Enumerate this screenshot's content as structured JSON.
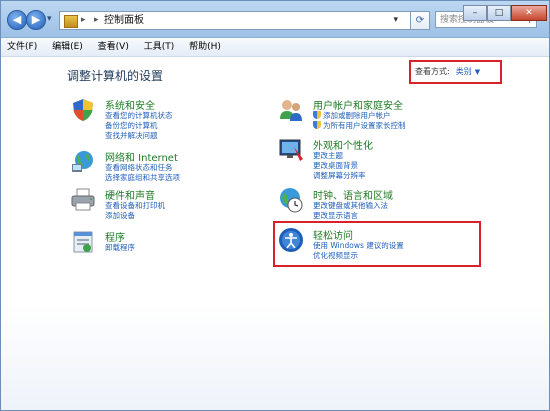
{
  "window": {
    "address_path": "控制面板",
    "search_placeholder": "搜索控制面板"
  },
  "menu": [
    "文件(F)",
    "编辑(E)",
    "查看(V)",
    "工具(T)",
    "帮助(H)"
  ],
  "main": {
    "heading": "调整计算机的设置",
    "view_by_label": "查看方式:",
    "view_by_value": "类别"
  },
  "categories": [
    {
      "title": "系统和安全",
      "links": [
        "查看您的计算机状态",
        "备份您的计算机",
        "查找并解决问题"
      ]
    },
    {
      "title": "网络和 Internet",
      "links": [
        "查看网络状态和任务",
        "选择家庭组和共享选项"
      ]
    },
    {
      "title": "硬件和声音",
      "links": [
        "查看设备和打印机",
        "添加设备"
      ]
    },
    {
      "title": "程序",
      "links": [
        "卸载程序"
      ]
    },
    {
      "title": "用户帐户和家庭安全",
      "links": [
        "添加或删除用户帐户",
        "为所有用户设置家长控制"
      ]
    },
    {
      "title": "外观和个性化",
      "links": [
        "更改主题",
        "更改桌面背景",
        "调整屏幕分辨率"
      ]
    },
    {
      "title": "时钟、语言和区域",
      "links": [
        "更改键盘或其他输入法",
        "更改显示语言"
      ]
    },
    {
      "title": "轻松访问",
      "links": [
        "使用 Windows 建议的设置",
        "优化视频显示"
      ]
    }
  ]
}
